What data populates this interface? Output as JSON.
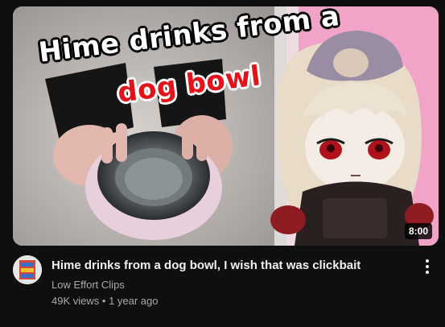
{
  "video": {
    "thumbnail_caption_line1": "Hime drinks from a",
    "thumbnail_caption_line2": "dog bowl",
    "duration": "8:00",
    "title": "Hime drinks from a dog bowl, I wish that was clickbait",
    "channel": "Low Effort Clips",
    "views": "49K views",
    "separator": "•",
    "age": "1 year ago"
  },
  "icons": {
    "avatar": "channel-avatar",
    "more": "more-vert-icon"
  },
  "colors": {
    "background": "#0f0f0f",
    "title": "#f1f1f1",
    "secondary": "#aaaaaa",
    "thumbnail_pink": "#f2a3c8",
    "caption_red": "#e5121b"
  }
}
